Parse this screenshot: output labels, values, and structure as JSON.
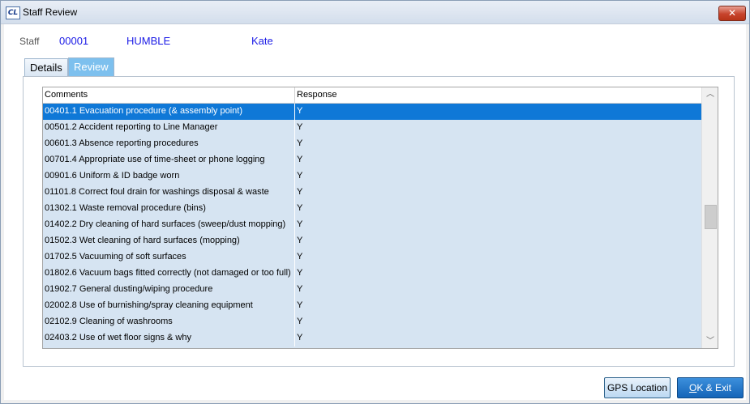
{
  "window": {
    "title": "Staff Review",
    "app_icon_text": "CL"
  },
  "staff": {
    "label": "Staff",
    "id": "00001",
    "last_name": "HUMBLE",
    "first_name": "Kate"
  },
  "tabs": [
    {
      "label": "Details",
      "active": false
    },
    {
      "label": "Review",
      "active": true
    }
  ],
  "grid": {
    "columns": [
      "Comments",
      "Response"
    ],
    "rows": [
      {
        "comment": "00401.1 Evacuation procedure (& assembly point)",
        "response": "Y",
        "selected": true
      },
      {
        "comment": "00501.2 Accident reporting to Line Manager",
        "response": "Y"
      },
      {
        "comment": "00601.3 Absence reporting procedures",
        "response": "Y"
      },
      {
        "comment": "00701.4 Appropriate use of time-sheet or phone logging",
        "response": "Y"
      },
      {
        "comment": "00901.6 Uniform & ID badge worn",
        "response": "Y"
      },
      {
        "comment": "01101.8 Correct foul drain for washings disposal & waste",
        "response": "Y"
      },
      {
        "comment": "01302.1 Waste removal procedure (bins)",
        "response": "Y"
      },
      {
        "comment": "01402.2 Dry cleaning of hard surfaces (sweep/dust mopping)",
        "response": "Y"
      },
      {
        "comment": "01502.3 Wet cleaning of hard surfaces (mopping)",
        "response": "Y"
      },
      {
        "comment": "01702.5 Vacuuming of soft surfaces",
        "response": "Y"
      },
      {
        "comment": "01802.6 Vacuum bags fitted correctly (not damaged or too full)",
        "response": "Y"
      },
      {
        "comment": "01902.7 General dusting/wiping procedure",
        "response": "Y"
      },
      {
        "comment": "02002.8 Use of burnishing/spray cleaning equipment",
        "response": "Y"
      },
      {
        "comment": "02102.9 Cleaning of washrooms",
        "response": "Y"
      },
      {
        "comment": "02403.2 Use of wet floor signs & why",
        "response": "Y"
      }
    ]
  },
  "buttons": {
    "gps": "GPS Location",
    "ok_accel": "O",
    "ok_rest": "K & Exit"
  },
  "icons": {
    "close": "close-icon",
    "scroll_up": "chevron-up-icon",
    "scroll_down": "chevron-down-icon"
  }
}
